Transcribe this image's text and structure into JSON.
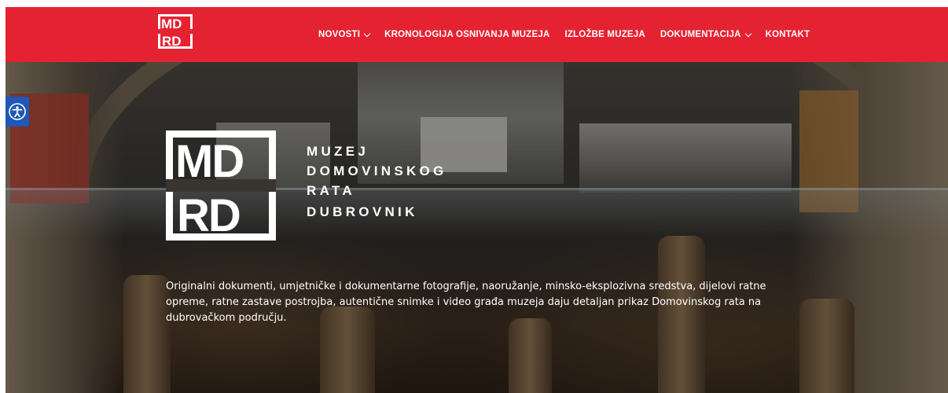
{
  "header": {
    "logo_letters": [
      "M",
      "D",
      "R",
      "D"
    ],
    "nav": [
      {
        "label": "NOVOSTI",
        "has_dropdown": true
      },
      {
        "label": "KRONOLOGIJA OSNIVANJA MUZEJA",
        "has_dropdown": false
      },
      {
        "label": "IZLOŽBE MUZEJA",
        "has_dropdown": false
      },
      {
        "label": "DOKUMENTACIJA",
        "has_dropdown": true
      },
      {
        "label": "KONTAKT",
        "has_dropdown": false
      }
    ]
  },
  "hero": {
    "brand_lines": [
      "MUZEJ",
      "DOMOVINSKOG",
      "RATA",
      "DUBROVNIK"
    ],
    "description": "Originalni dokumenti, umjetničke i dokumentarne fotografije, naoružanje, minsko-eksplozivna sredstva, dijelovi ratne opreme, ratne zastave postrojba, autentične snimke i video građa muzeja daju detaljan prikaz Domovinskog rata na dubrovačkom području."
  },
  "accessibility": {
    "icon": "accessibility-icon"
  },
  "colors": {
    "header_bg": "#e52231",
    "accessibility_bg": "#1f58b6",
    "text": "#ffffff"
  }
}
